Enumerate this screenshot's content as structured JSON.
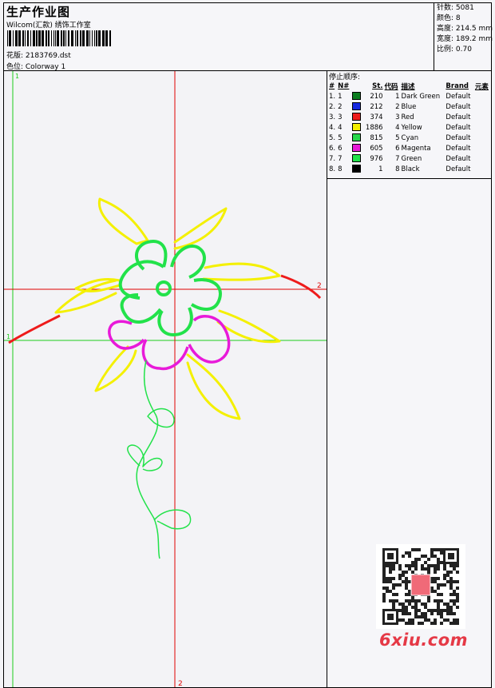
{
  "header": {
    "title": "生产作业图",
    "company": "Wilcom(汇款) 绣饰工作室",
    "design_label": "花版: 2183769.dst",
    "colorway_label": "色位: Colorway 1",
    "stats": [
      "针数: 5081",
      "颜色: 8",
      "高度: 214.5 mm",
      "宽度: 189.2 mm",
      "比例: 0.70"
    ]
  },
  "axes": {
    "top_marker_green": "1",
    "left_marker_green": "1",
    "right_marker_red": "2",
    "bottom_marker_red": "2"
  },
  "stop_sequence": {
    "title": "停止顺序:",
    "columns": [
      "#",
      "N#",
      "St.",
      "代码",
      "描述",
      "Brand",
      "元素"
    ],
    "rows": [
      {
        "idx": "1.",
        "n": "1",
        "color": "#0b7d1f",
        "st": "210",
        "code": "1",
        "desc": "Dark Green",
        "brand": "Default"
      },
      {
        "idx": "2.",
        "n": "2",
        "color": "#1628e0",
        "st": "212",
        "code": "2",
        "desc": "Blue",
        "brand": "Default"
      },
      {
        "idx": "3.",
        "n": "3",
        "color": "#ee1b1b",
        "st": "374",
        "code": "3",
        "desc": "Red",
        "brand": "Default"
      },
      {
        "idx": "4.",
        "n": "4",
        "color": "#f4f000",
        "st": "1886",
        "code": "4",
        "desc": "Yellow",
        "brand": "Default"
      },
      {
        "idx": "5.",
        "n": "5",
        "color": "#27d84a",
        "st": "815",
        "code": "5",
        "desc": "Cyan",
        "brand": "Default"
      },
      {
        "idx": "6.",
        "n": "6",
        "color": "#e81ad9",
        "st": "605",
        "code": "6",
        "desc": "Magenta",
        "brand": "Default"
      },
      {
        "idx": "7.",
        "n": "7",
        "color": "#22e24a",
        "st": "976",
        "code": "7",
        "desc": "Green",
        "brand": "Default"
      },
      {
        "idx": "8.",
        "n": "8",
        "color": "#000000",
        "st": "1",
        "code": "8",
        "desc": "Black",
        "brand": "Default"
      }
    ]
  },
  "watermark": "6xiu.com",
  "colors": {
    "stitch_yellow": "#f4f000",
    "stitch_green": "#22e24a",
    "stitch_magenta": "#e81ad9",
    "stitch_red": "#ee1b1b",
    "axis_red": "#e00000",
    "axis_green": "#1ccc1c"
  }
}
